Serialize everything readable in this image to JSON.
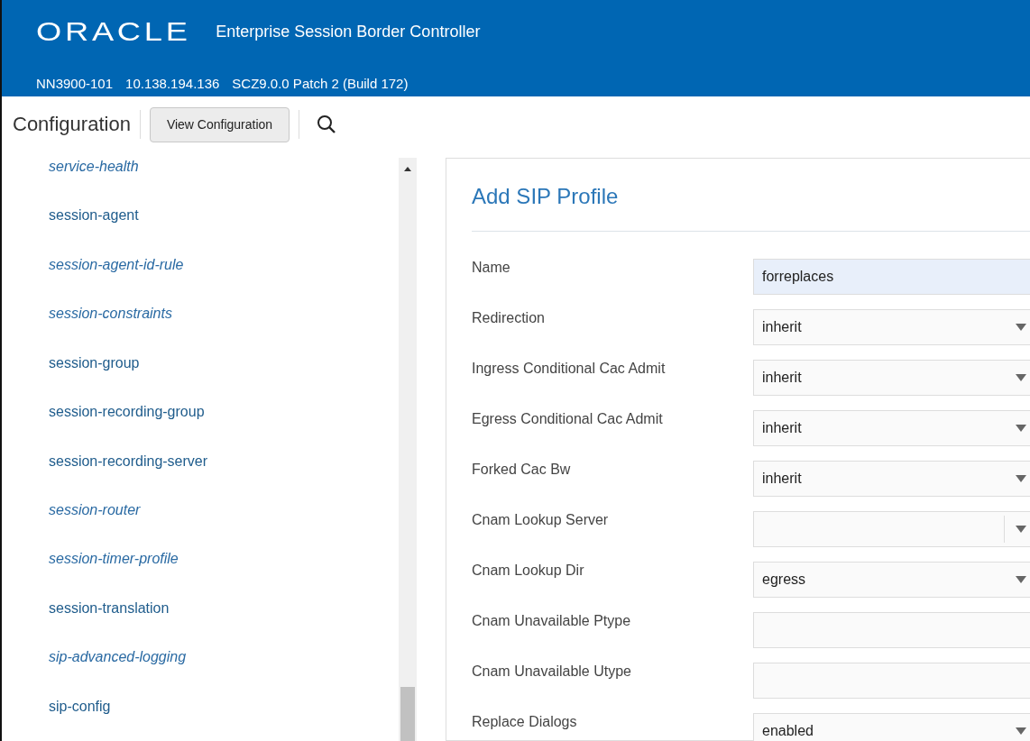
{
  "header": {
    "logo": "ORACLE",
    "product": "Enterprise Session Border Controller",
    "info": [
      "NN3900-101",
      "10.138.194.136",
      "SCZ9.0.0 Patch 2 (Build 172)"
    ]
  },
  "toolbar": {
    "title": "Configuration",
    "button": "View Configuration"
  },
  "sidebar": {
    "items": [
      {
        "label": "service-health",
        "italic": true
      },
      {
        "label": "session-agent",
        "italic": false
      },
      {
        "label": "session-agent-id-rule",
        "italic": true
      },
      {
        "label": "session-constraints",
        "italic": true
      },
      {
        "label": "session-group",
        "italic": false
      },
      {
        "label": "session-recording-group",
        "italic": false
      },
      {
        "label": "session-recording-server",
        "italic": false
      },
      {
        "label": "session-router",
        "italic": true
      },
      {
        "label": "session-timer-profile",
        "italic": true
      },
      {
        "label": "session-translation",
        "italic": false
      },
      {
        "label": "sip-advanced-logging",
        "italic": true
      },
      {
        "label": "sip-config",
        "italic": false
      }
    ]
  },
  "form": {
    "title": "Add SIP Profile",
    "fields": [
      {
        "label": "Name",
        "kind": "text",
        "value": "forreplaces",
        "focused": true
      },
      {
        "label": "Redirection",
        "kind": "select",
        "value": "inherit",
        "focused": false
      },
      {
        "label": "Ingress Conditional Cac Admit",
        "kind": "select",
        "value": "inherit",
        "focused": false
      },
      {
        "label": "Egress Conditional Cac Admit",
        "kind": "select",
        "value": "inherit",
        "focused": false
      },
      {
        "label": "Forked Cac Bw",
        "kind": "select",
        "value": "inherit",
        "focused": false
      },
      {
        "label": "Cnam Lookup Server",
        "kind": "combo",
        "focused": false
      },
      {
        "label": "Cnam Lookup Dir",
        "kind": "select",
        "value": "egress",
        "focused": false
      },
      {
        "label": "Cnam Unavailable Ptype",
        "kind": "text",
        "focused": false
      },
      {
        "label": "Cnam Unavailable Utype",
        "kind": "text",
        "focused": false
      },
      {
        "label": "Replace Dialogs",
        "kind": "select",
        "value": "enabled",
        "focused": false
      }
    ]
  }
}
